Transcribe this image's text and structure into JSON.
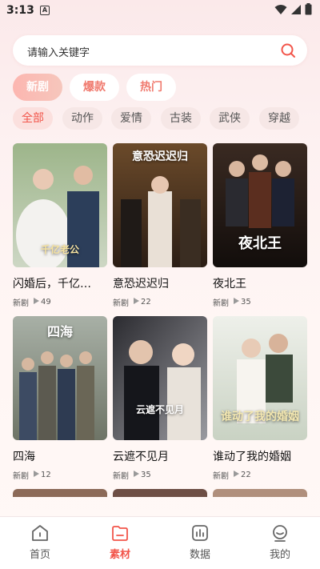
{
  "status": {
    "time": "3:13",
    "notif": "A"
  },
  "search": {
    "placeholder": "请输入关键字"
  },
  "top_tabs": [
    {
      "label": "新剧",
      "active": true
    },
    {
      "label": "爆款",
      "active": false
    },
    {
      "label": "热门",
      "active": false
    }
  ],
  "genres": [
    "全部",
    "动作",
    "爱情",
    "古装",
    "武侠",
    "穿越"
  ],
  "grid": [
    {
      "title": "闪婚后，千亿…",
      "tag": "新剧",
      "plays": "49",
      "poster_text": "千亿老公"
    },
    {
      "title": "意恐迟迟归",
      "tag": "新剧",
      "plays": "22",
      "poster_text": "意恐迟迟归"
    },
    {
      "title": "夜北王",
      "tag": "新剧",
      "plays": "35",
      "poster_text": "夜北王"
    },
    {
      "title": "四海",
      "tag": "新剧",
      "plays": "12",
      "poster_text": "四海"
    },
    {
      "title": "云遮不见月",
      "tag": "新剧",
      "plays": "35",
      "poster_text": "云遮不见月"
    },
    {
      "title": "谁动了我的婚姻",
      "tag": "新剧",
      "plays": "22",
      "poster_text": "谁动了我的婚姻"
    }
  ],
  "nav": [
    {
      "label": "首页",
      "icon": "home-icon",
      "active": false
    },
    {
      "label": "素材",
      "icon": "folder-icon",
      "active": true
    },
    {
      "label": "数据",
      "icon": "chart-icon",
      "active": false
    },
    {
      "label": "我的",
      "icon": "profile-icon",
      "active": false
    }
  ],
  "colors": {
    "accent": "#f2554a",
    "pill_gradient": "#fcb6b0"
  }
}
